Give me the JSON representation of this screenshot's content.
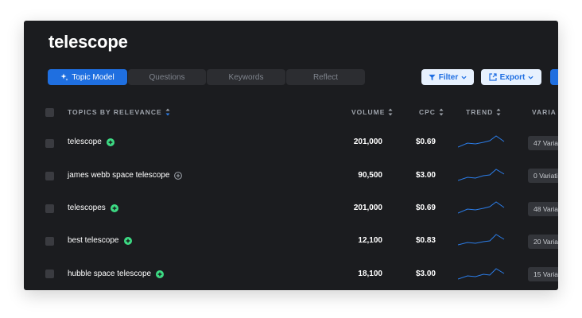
{
  "title": "telescope",
  "tabs": [
    {
      "label": "Topic Model",
      "active": true
    },
    {
      "label": "Questions",
      "active": false
    },
    {
      "label": "Keywords",
      "active": false
    },
    {
      "label": "Reflect",
      "active": false
    }
  ],
  "toolbar": {
    "filter_label": "Filter",
    "export_label": "Export"
  },
  "columns": {
    "topics": "TOPICS BY RELEVANCE",
    "volume": "VOLUME",
    "cpc": "CPC",
    "trend": "TREND",
    "variations": "VARIA"
  },
  "rows": [
    {
      "topic": "telescope",
      "volume": "201,000",
      "cpc": "$0.69",
      "variations": "47 Varia",
      "added": true
    },
    {
      "topic": "james webb space telescope",
      "volume": "90,500",
      "cpc": "$3.00",
      "variations": "0 Variati",
      "added": false
    },
    {
      "topic": "telescopes",
      "volume": "201,000",
      "cpc": "$0.69",
      "variations": "48 Varia",
      "added": true
    },
    {
      "topic": "best telescope",
      "volume": "12,100",
      "cpc": "$0.83",
      "variations": "20 Varia",
      "added": true
    },
    {
      "topic": "hubble space telescope",
      "volume": "18,100",
      "cpc": "$3.00",
      "variations": "15 Varia",
      "added": true
    }
  ],
  "colors": {
    "accent": "#1f6fe0",
    "added_icon": "#3ddc84",
    "trend_line": "#2b7de9"
  },
  "icons": {
    "topic_model": "sparkle-icon",
    "filter": "filter-icon",
    "export": "export-icon",
    "sort": "sort-icon",
    "add": "plus-circle-icon"
  }
}
